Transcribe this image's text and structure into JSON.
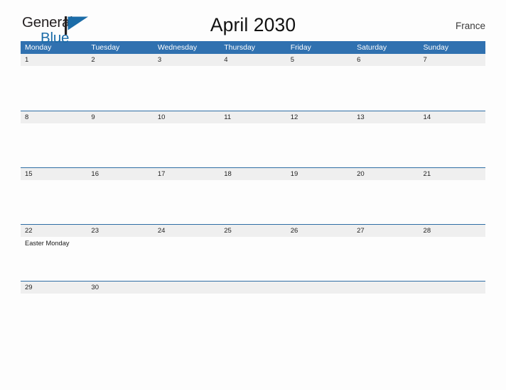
{
  "brand": {
    "name_part1": "General",
    "name_part2": "Blue",
    "logo_icon": "blue-flag-triangle-icon",
    "color_primary": "#1b6ca8",
    "color_text": "#231f20"
  },
  "header": {
    "title": "April 2030",
    "country": "France"
  },
  "colors": {
    "header_row_blue": "#3071b0",
    "week_divider_blue": "#2e6da4",
    "date_band_gray": "#efefef",
    "page_background": "#fdfdfd"
  },
  "calendar": {
    "weekdays": [
      "Monday",
      "Tuesday",
      "Wednesday",
      "Thursday",
      "Friday",
      "Saturday",
      "Sunday"
    ],
    "weeks": [
      {
        "days": [
          {
            "date": "1",
            "events": []
          },
          {
            "date": "2",
            "events": []
          },
          {
            "date": "3",
            "events": []
          },
          {
            "date": "4",
            "events": []
          },
          {
            "date": "5",
            "events": []
          },
          {
            "date": "6",
            "events": []
          },
          {
            "date": "7",
            "events": []
          }
        ]
      },
      {
        "days": [
          {
            "date": "8",
            "events": []
          },
          {
            "date": "9",
            "events": []
          },
          {
            "date": "10",
            "events": []
          },
          {
            "date": "11",
            "events": []
          },
          {
            "date": "12",
            "events": []
          },
          {
            "date": "13",
            "events": []
          },
          {
            "date": "14",
            "events": []
          }
        ]
      },
      {
        "days": [
          {
            "date": "15",
            "events": []
          },
          {
            "date": "16",
            "events": []
          },
          {
            "date": "17",
            "events": []
          },
          {
            "date": "18",
            "events": []
          },
          {
            "date": "19",
            "events": []
          },
          {
            "date": "20",
            "events": []
          },
          {
            "date": "21",
            "events": []
          }
        ]
      },
      {
        "days": [
          {
            "date": "22",
            "events": [
              "Easter Monday"
            ]
          },
          {
            "date": "23",
            "events": []
          },
          {
            "date": "24",
            "events": []
          },
          {
            "date": "25",
            "events": []
          },
          {
            "date": "26",
            "events": []
          },
          {
            "date": "27",
            "events": []
          },
          {
            "date": "28",
            "events": []
          }
        ]
      },
      {
        "short": true,
        "days": [
          {
            "date": "29",
            "events": []
          },
          {
            "date": "30",
            "events": []
          },
          {
            "date": "",
            "events": []
          },
          {
            "date": "",
            "events": []
          },
          {
            "date": "",
            "events": []
          },
          {
            "date": "",
            "events": []
          },
          {
            "date": "",
            "events": []
          }
        ]
      }
    ]
  }
}
